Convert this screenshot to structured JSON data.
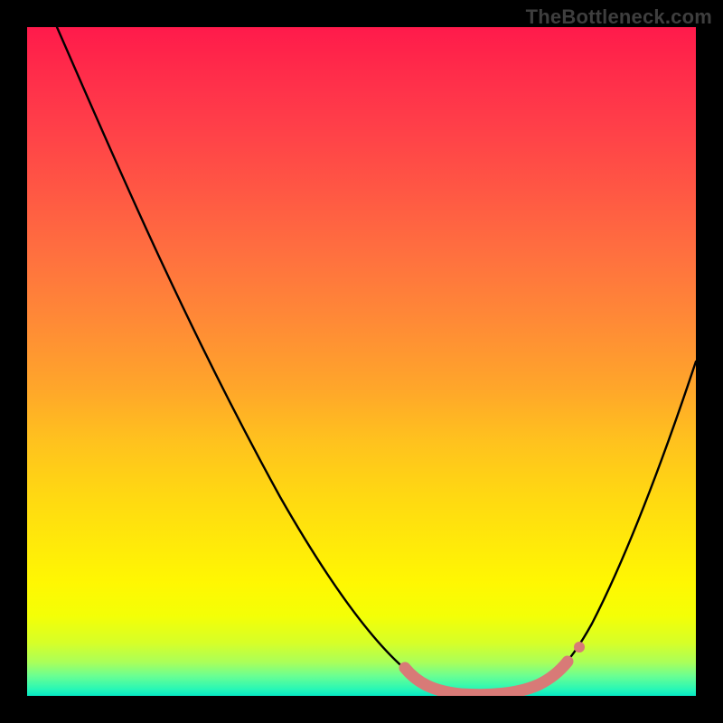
{
  "watermark": "TheBottleneck.com",
  "gradient_colors": {
    "top": "#ff1a4b",
    "mid_upper": "#ff8a36",
    "mid": "#ffe90a",
    "mid_lower": "#d7ff27",
    "bottom": "#06e8c4"
  },
  "chart_data": {
    "type": "line",
    "title": "",
    "xlabel": "",
    "ylabel": "",
    "xlim": [
      0,
      100
    ],
    "ylim": [
      0,
      100
    ],
    "x": [
      5,
      10,
      15,
      20,
      25,
      30,
      35,
      40,
      45,
      50,
      54,
      58,
      62,
      66,
      70,
      74,
      78,
      82,
      86,
      90,
      95,
      100
    ],
    "values": [
      100,
      89,
      78,
      68,
      58,
      49,
      41,
      33,
      26,
      19,
      13,
      8,
      4,
      1,
      0,
      0,
      1,
      4,
      11,
      20,
      33,
      49
    ],
    "trough_marker": {
      "color": "#d87a77",
      "thickness_px": 13,
      "x_range": [
        55,
        80
      ],
      "y": 0
    },
    "grid": false,
    "legend": false
  }
}
